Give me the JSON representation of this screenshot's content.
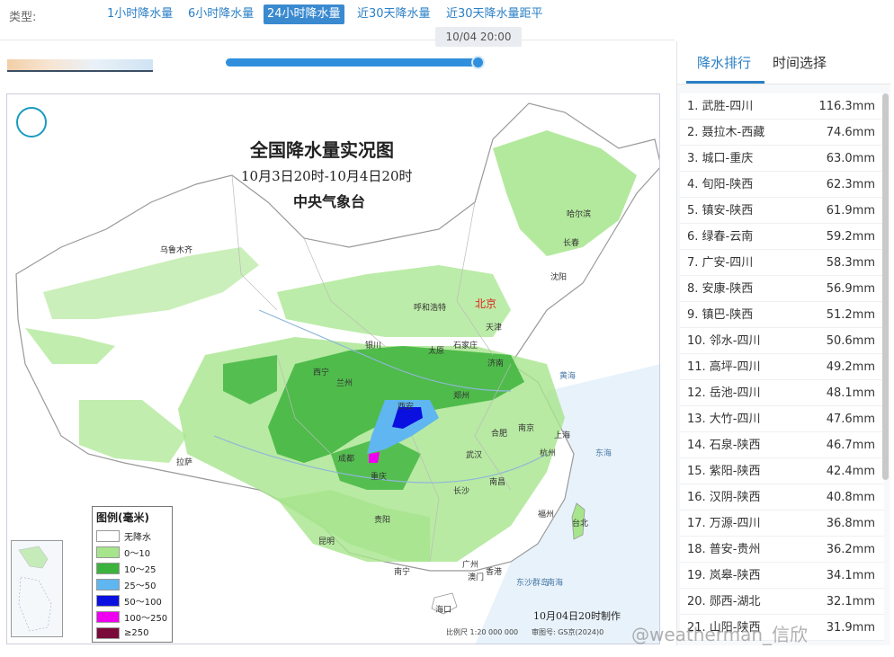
{
  "typebar": {
    "label": "类型:",
    "tabs": [
      "1小时降水量",
      "6小时降水量",
      "24小时降水量",
      "近30天降水量",
      "近30天降水量距平"
    ],
    "active_index": 2
  },
  "timeline": {
    "current_time": "10/04 20:00",
    "progress": 1.0
  },
  "map": {
    "title": "全国降水量实况图",
    "subtitle": "10月3日20时-10月4日20时",
    "org": "中央气象台",
    "made": "10月04日20时制作",
    "scale": "比例尺 1:20 000 000",
    "approval": "审图号: GS京(2024)0",
    "legend": {
      "title": "图例(毫米)",
      "items": [
        {
          "label": "无降水",
          "color": "#ffffff"
        },
        {
          "label": "0～10",
          "color": "#a6e58c"
        },
        {
          "label": "10～25",
          "color": "#3cb33c"
        },
        {
          "label": "25～50",
          "color": "#5fb6f0"
        },
        {
          "label": "50～100",
          "color": "#0a10e0"
        },
        {
          "label": "100～250",
          "color": "#f000f0"
        },
        {
          "label": "≥250",
          "color": "#7a0a3a"
        }
      ]
    },
    "cities": [
      "乌鲁木齐",
      "哈尔滨",
      "长春",
      "沈阳",
      "呼和浩特",
      "北京",
      "天津",
      "银川",
      "太原",
      "石家庄",
      "济南",
      "西宁",
      "兰州",
      "西安",
      "郑州",
      "拉萨",
      "成都",
      "重庆",
      "合肥",
      "南京",
      "上海",
      "武汉",
      "杭州",
      "南昌",
      "长沙",
      "贵阳",
      "福州",
      "台北",
      "昆明",
      "南宁",
      "广州",
      "香港",
      "澳门",
      "海口"
    ],
    "capital": "北京",
    "seas": [
      "黄海",
      "东海",
      "南海",
      "东沙群岛"
    ]
  },
  "rank_panel": {
    "tabs": [
      "降水排行",
      "时间选择"
    ],
    "active_index": 0,
    "items": [
      {
        "name": "1. 武胜-四川",
        "value": "116.3mm"
      },
      {
        "name": "2. 聂拉木-西藏",
        "value": "74.6mm"
      },
      {
        "name": "3. 城口-重庆",
        "value": "63.0mm"
      },
      {
        "name": "4. 旬阳-陕西",
        "value": "62.3mm"
      },
      {
        "name": "5. 镇安-陕西",
        "value": "61.9mm"
      },
      {
        "name": "6. 绿春-云南",
        "value": "59.2mm"
      },
      {
        "name": "7. 广安-四川",
        "value": "58.3mm"
      },
      {
        "name": "8. 安康-陕西",
        "value": "56.9mm"
      },
      {
        "name": "9. 镇巴-陕西",
        "value": "51.2mm"
      },
      {
        "name": "10. 邻水-四川",
        "value": "50.6mm"
      },
      {
        "name": "11. 高坪-四川",
        "value": "49.2mm"
      },
      {
        "name": "12. 岳池-四川",
        "value": "48.1mm"
      },
      {
        "name": "13. 大竹-四川",
        "value": "47.6mm"
      },
      {
        "name": "14. 石泉-陕西",
        "value": "46.7mm"
      },
      {
        "name": "15. 紫阳-陕西",
        "value": "42.4mm"
      },
      {
        "name": "16. 汉阴-陕西",
        "value": "40.8mm"
      },
      {
        "name": "17. 万源-四川",
        "value": "36.8mm"
      },
      {
        "name": "18. 普安-贵州",
        "value": "36.2mm"
      },
      {
        "name": "19. 岚皋-陕西",
        "value": "34.1mm"
      },
      {
        "name": "20. 郧西-湖北",
        "value": "32.1mm"
      },
      {
        "name": "21. 山阳-陕西",
        "value": "31.9mm"
      }
    ]
  },
  "watermark": "@weatherman_信欣"
}
